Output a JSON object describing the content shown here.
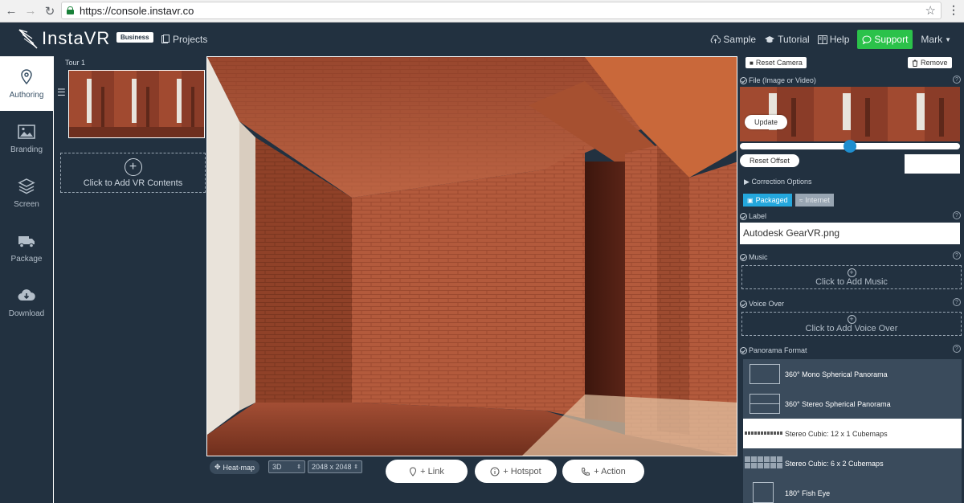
{
  "browser": {
    "url": "https://console.instavr.co"
  },
  "header": {
    "logo": "InstaVR",
    "plan_badge": "Business",
    "projects": "Projects",
    "sample": "Sample",
    "tutorial": "Tutorial",
    "help": "Help",
    "support": "Support",
    "user": "Mark"
  },
  "sidebar": {
    "items": [
      {
        "label": "Authoring",
        "icon": "location-pin-icon",
        "active": true
      },
      {
        "label": "Branding",
        "icon": "image-icon",
        "active": false
      },
      {
        "label": "Screen",
        "icon": "layers-icon",
        "active": false
      },
      {
        "label": "Package",
        "icon": "truck-icon",
        "active": false
      },
      {
        "label": "Download",
        "icon": "cloud-download-icon",
        "active": false
      }
    ]
  },
  "tour": {
    "title": "Tour 1",
    "add_contents": "Click to Add VR Contents"
  },
  "viewer_toolbar": {
    "heatmap": "Heat-map",
    "mode": "3D",
    "resolution": "2048 x 2048",
    "link": "+ Link",
    "hotspot": "+ Hotspot",
    "action": "+ Action"
  },
  "right_panel": {
    "reset_camera": "Reset Camera",
    "remove": "Remove",
    "file_label": "File (Image or Video)",
    "update": "Update",
    "offset_value": 0.5,
    "reset_offset": "Reset Offset",
    "correction_options": "Correction Options",
    "packaged": "Packaged",
    "internet": "Internet",
    "label_title": "Label",
    "label_value": "Autodesk GearVR.png",
    "music_title": "Music",
    "add_music": "Click to Add Music",
    "voiceover_title": "Voice Over",
    "add_voiceover": "Click to Add Voice Over",
    "format_title": "Panorama Format",
    "formats": [
      {
        "label": "360° Mono Spherical Panorama",
        "selected": false
      },
      {
        "label": "360° Stereo Spherical Panorama",
        "selected": false
      },
      {
        "label": "Stereo Cubic: 12 x 1 Cubemaps",
        "selected": true
      },
      {
        "label": "Stereo Cubic: 6 x 2 Cubemaps",
        "selected": false
      },
      {
        "label": "180° Fish Eye",
        "selected": false
      }
    ]
  },
  "colors": {
    "bg": "#223140",
    "support_green": "#2bc24a",
    "packaged_blue": "#24a7dd",
    "slider_blue": "#1f8ecf"
  }
}
